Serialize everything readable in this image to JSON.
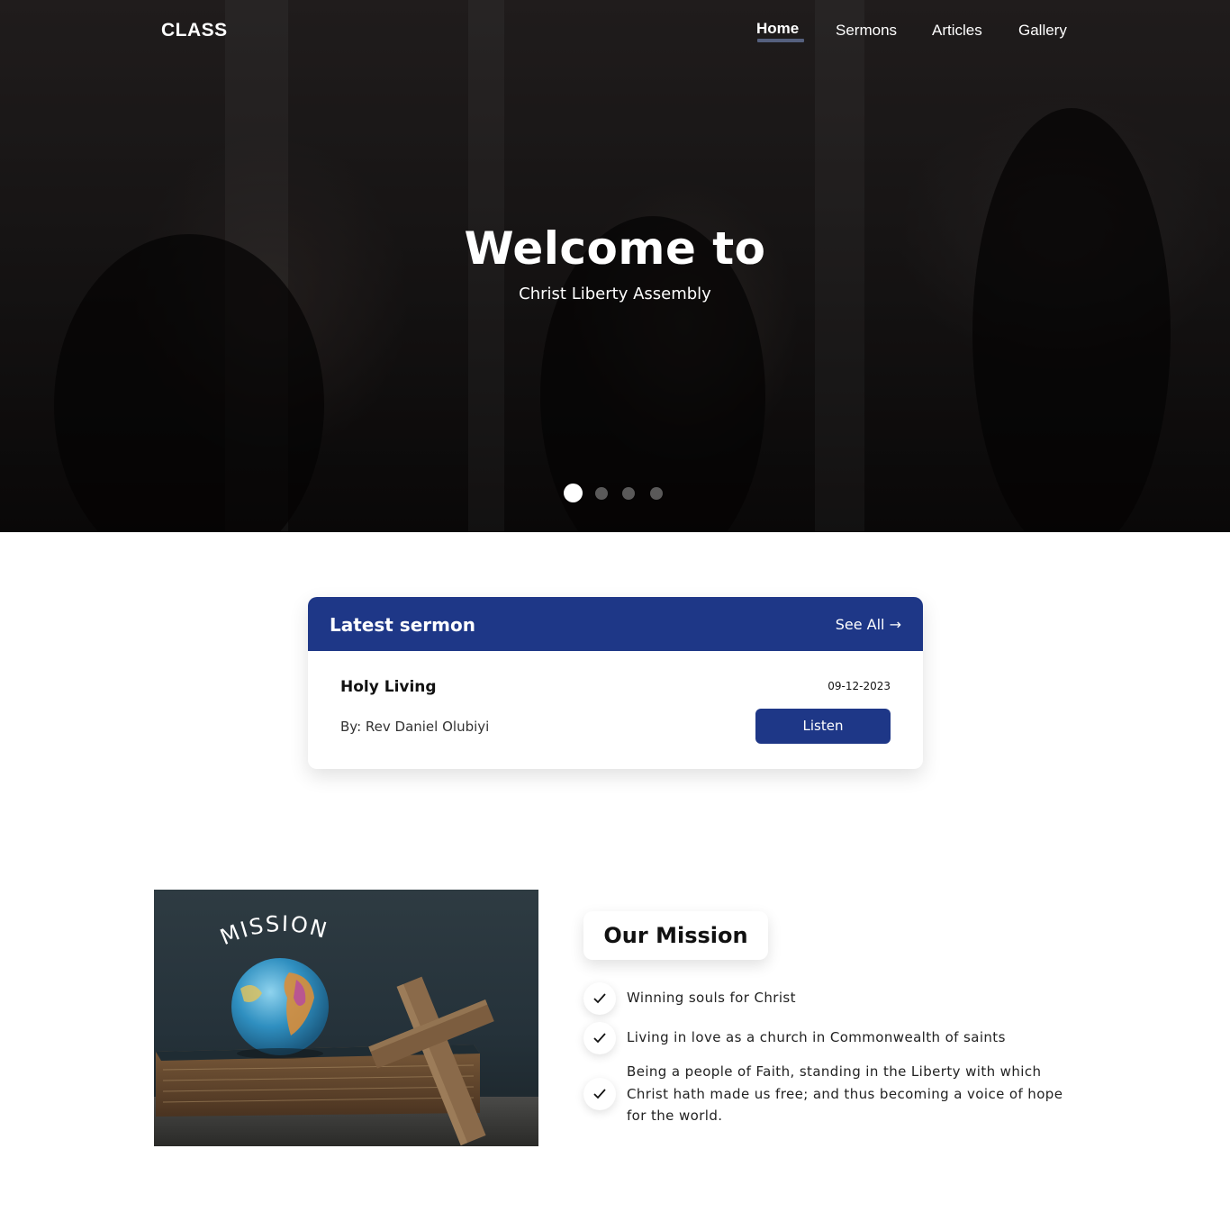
{
  "brand": {
    "logo": "CLASS"
  },
  "nav": {
    "items": [
      {
        "label": "Home",
        "active": true
      },
      {
        "label": "Sermons",
        "active": false
      },
      {
        "label": "Articles",
        "active": false
      },
      {
        "label": "Gallery",
        "active": false
      }
    ]
  },
  "hero": {
    "title": "Welcome to",
    "subtitle": "Christ Liberty Assembly",
    "slides_total": 4,
    "active_slide": 1
  },
  "latest_sermon": {
    "heading": "Latest sermon",
    "see_all_label": "See All →",
    "title": "Holy Living",
    "date": "09-12-2023",
    "author": "By: Rev Daniel Olubiyi",
    "listen_label": "Listen"
  },
  "mission": {
    "image_text": "MISSION",
    "title": "Our Mission",
    "items": [
      "Winning souls for Christ",
      "Living in love as a church in Commonwealth of saints",
      "Being a people of Faith, standing in the Liberty with which Christ hath made us free; and thus becoming a voice of hope for the world."
    ]
  },
  "colors": {
    "accent": "#1e3787",
    "hero_overlay": "#1e1b1b",
    "text": "#111111"
  }
}
